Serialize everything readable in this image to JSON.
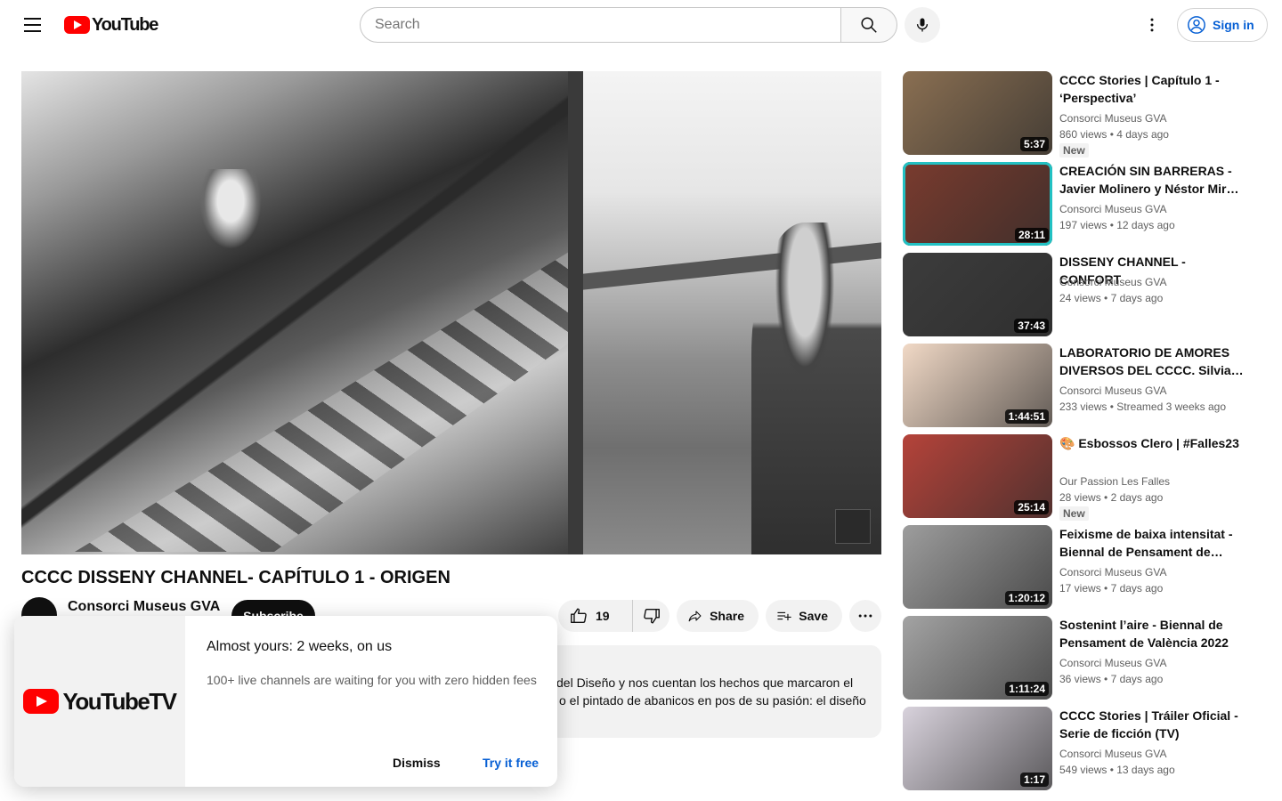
{
  "header": {
    "logo_text": "YouTube",
    "search_placeholder": "Search",
    "signin_label": "Sign in"
  },
  "video": {
    "title": "CCCC DISSENY CHANNEL- CAPÍTULO 1 - ORIGEN",
    "channel": "Consorci Museus GVA",
    "subscribe_label": "Subscribe",
    "likes": "19",
    "share_label": "Share",
    "save_label": "Save",
    "description_line1": "del Diseño y nos cuentan los hechos que marcaron el",
    "description_line2": "o el pintado de abanicos en pos de su pasión: el diseño"
  },
  "promo": {
    "brand": "YouTubeTV",
    "title": "Almost yours: 2 weeks, on us",
    "subtitle": "100+ live channels are waiting for you with zero hidden fees",
    "dismiss_label": "Dismiss",
    "cta_label": "Try it free"
  },
  "recommendations": [
    {
      "title": "CCCC Stories | Capítulo 1 - ‘Perspectiva’",
      "channel": "Consorci Museus GVA",
      "views": "860 views",
      "age": "4 days ago",
      "badge": "New",
      "duration": "5:37",
      "thumb_color": "#8a6f52"
    },
    {
      "title": "CREACIÓN SIN BARRERAS - Javier Molinero y Néstor Mir…",
      "channel": "Consorci Museus GVA",
      "views": "197 views",
      "age": "12 days ago",
      "badge": "",
      "duration": "28:11",
      "thumb_color": "#7a3b2e"
    },
    {
      "title": "DISSENY CHANNEL - CONFORT",
      "channel": "Consorci Museus GVA",
      "views": "24 views",
      "age": "7 days ago",
      "badge": "",
      "duration": "37:43",
      "thumb_color": "#3c3c3c"
    },
    {
      "title": "LABORATORIO DE AMORES DIVERSOS DEL CCCC. Silvia…",
      "channel": "Consorci Museus GVA",
      "views": "233 views",
      "age": "Streamed 3 weeks ago",
      "badge": "",
      "duration": "1:44:51",
      "thumb_color": "#f1d9c6"
    },
    {
      "title": "🎨 Esbossos Clero | #Falles23",
      "channel": "Our Passion Les Falles",
      "views": "28 views",
      "age": "2 days ago",
      "badge": "New",
      "duration": "25:14",
      "thumb_color": "#b5433a"
    },
    {
      "title": "Feixisme de baixa intensitat - Biennal de Pensament de…",
      "channel": "Consorci Museus GVA",
      "views": "17 views",
      "age": "7 days ago",
      "badge": "",
      "duration": "1:20:12",
      "thumb_color": "#9d9d9d"
    },
    {
      "title": "Sostenint l’aire - Biennal de Pensament de València 2022",
      "channel": "Consorci Museus GVA",
      "views": "36 views",
      "age": "7 days ago",
      "badge": "",
      "duration": "1:11:24",
      "thumb_color": "#a3a3a3"
    },
    {
      "title": "CCCC Stories | Tráiler Oficial - Serie de ficción (TV)",
      "channel": "Consorci Museus GVA",
      "views": "549 views",
      "age": "13 days ago",
      "badge": "",
      "duration": "1:17",
      "thumb_color": "#d8d2dc"
    }
  ]
}
